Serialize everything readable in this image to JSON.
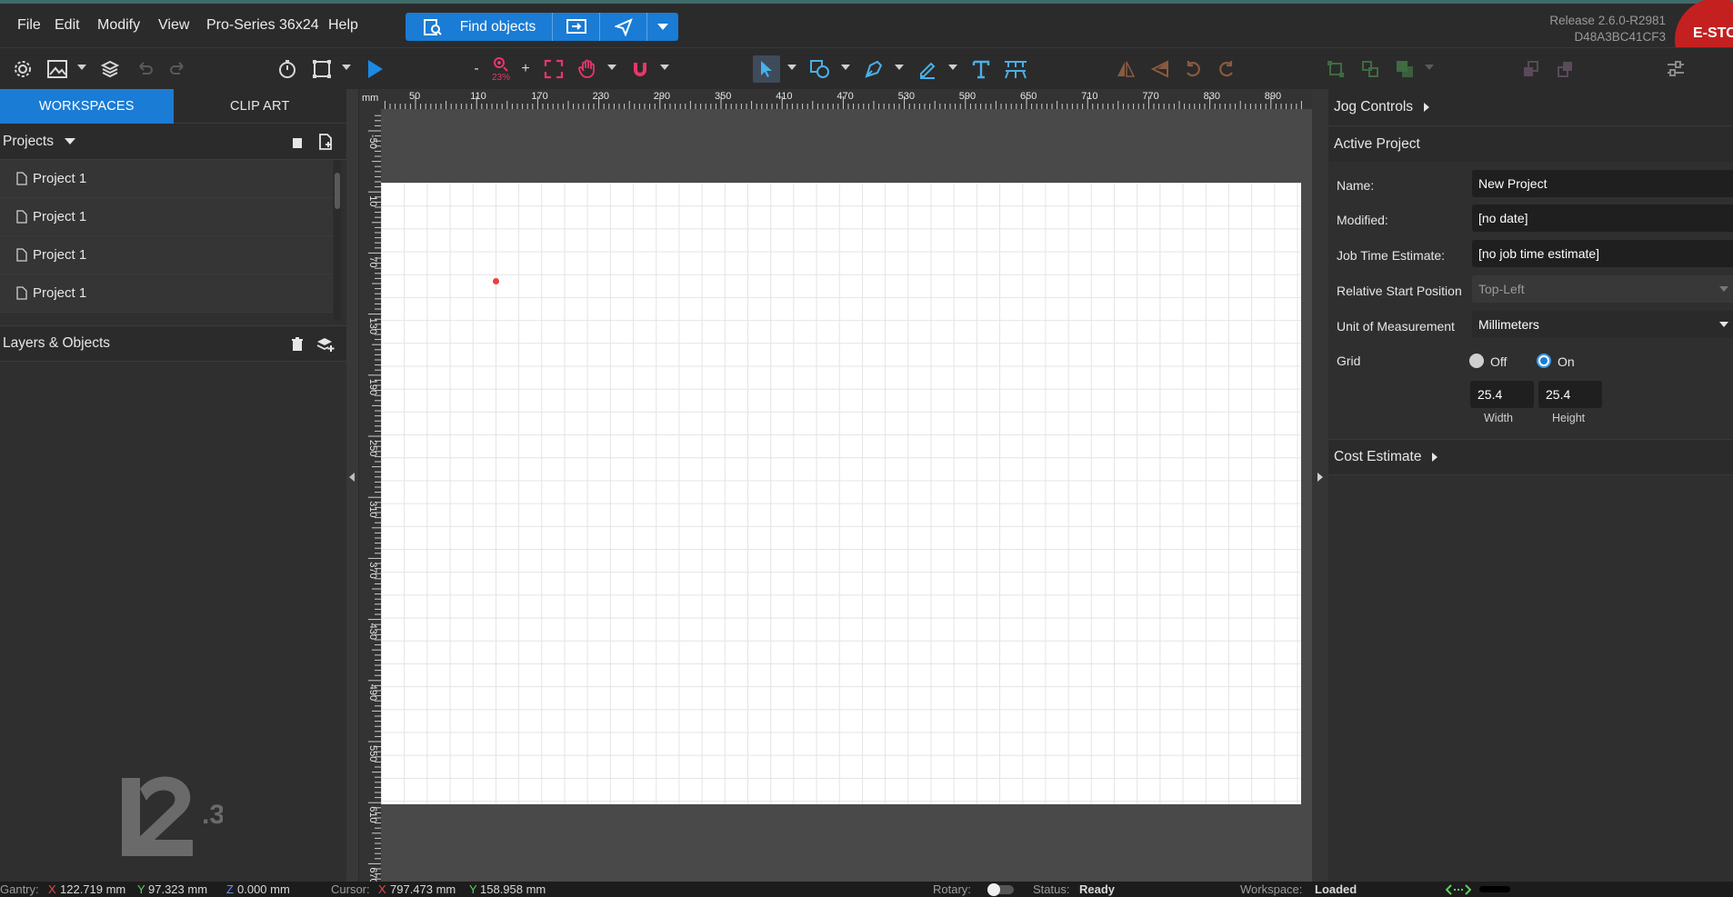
{
  "menu": {
    "file": "File",
    "edit": "Edit",
    "modify": "Modify",
    "view": "View",
    "machine": "Pro-Series 36x24",
    "help": "Help"
  },
  "find_objects": "Find objects",
  "release": {
    "line1": "Release 2.6.0-R2981",
    "line2": "D48A3BC41CF3"
  },
  "estop": "E-STOP",
  "zoom": {
    "minus": "-",
    "plus": "+",
    "level": "23%"
  },
  "left_tabs": {
    "workspaces": "WORKSPACES",
    "clip_art": "CLIP ART"
  },
  "projects": {
    "title": "Projects",
    "items": [
      "Project 1",
      "Project 1",
      "Project 1",
      "Project 1"
    ]
  },
  "layers_title": "Layers & Objects",
  "ruler": {
    "unit": "mm",
    "h_ticks": [
      "50",
      "110",
      "170",
      "230",
      "290",
      "350",
      "410",
      "470",
      "530",
      "590",
      "650",
      "710",
      "770",
      "830",
      "890"
    ],
    "v_ticks": [
      "-50",
      "10",
      "70",
      "130",
      "190",
      "250",
      "310",
      "370",
      "430",
      "490",
      "550",
      "610",
      "670"
    ]
  },
  "right": {
    "jog": "Jog Controls",
    "active": "Active Project",
    "name_label": "Name:",
    "name_value": "New Project",
    "modified_label": "Modified:",
    "modified_value": "[no date]",
    "job_label": "Job Time Estimate:",
    "job_value": "[no job time estimate]",
    "relstart_label": "Relative Start Position",
    "relstart_value": "Top-Left",
    "unit_label": "Unit of Measurement",
    "unit_value": "Millimeters",
    "grid_label": "Grid",
    "grid_off": "Off",
    "grid_on": "On",
    "grid_selected": "On",
    "width_value": "25.4",
    "height_value": "25.4",
    "width_label": "Width",
    "height_label": "Height",
    "cost": "Cost Estimate"
  },
  "status": {
    "gantry_label": "Gantry:",
    "gx_label": "X",
    "gx": "122.719 mm",
    "gy_label": "Y",
    "gy": "97.323 mm",
    "gz_label": "Z",
    "gz": "0.000 mm",
    "cursor_label": "Cursor:",
    "cx_label": "X",
    "cx": "797.473 mm",
    "cy_label": "Y",
    "cy": "158.958 mm",
    "rotary_label": "Rotary:",
    "status_label": "Status:",
    "status_value": "Ready",
    "workspace_label": "Workspace:",
    "workspace_value": "Loaded"
  },
  "colors": {
    "accent": "#1a7cd4",
    "estop": "#c42020",
    "marker": "#e84040"
  }
}
